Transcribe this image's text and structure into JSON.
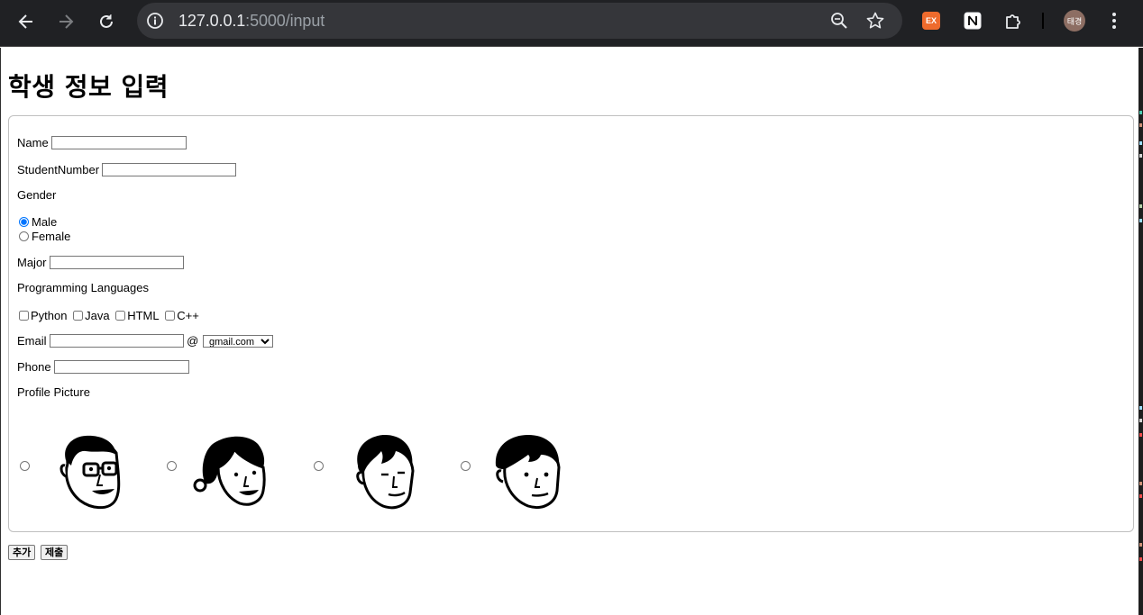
{
  "browser": {
    "url_host": "127.0.0.1",
    "url_path": ":5000/input",
    "extension_ex_label": "EX",
    "profile_initials": "태경"
  },
  "page": {
    "title": "학생 정보 입력"
  },
  "form": {
    "name_label": "Name",
    "name_value": "",
    "student_number_label": "StudentNumber",
    "student_number_value": "",
    "gender_label": "Gender",
    "gender_options": [
      "Male",
      "Female"
    ],
    "gender_selected": "Male",
    "major_label": "Major",
    "major_value": "",
    "languages_label": "Programming Languages",
    "languages": [
      "Python",
      "Java",
      "HTML",
      "C++"
    ],
    "email_label": "Email",
    "email_value": "",
    "email_at": "@",
    "email_domain_selected": "gmail.com",
    "phone_label": "Phone",
    "phone_value": "",
    "profile_picture_label": "Profile Picture",
    "profile_pictures": [
      "face-glasses",
      "face-ponytail",
      "face-bangs",
      "face-plain"
    ]
  },
  "buttons": {
    "add_label": "추가",
    "submit_label": "제출"
  }
}
